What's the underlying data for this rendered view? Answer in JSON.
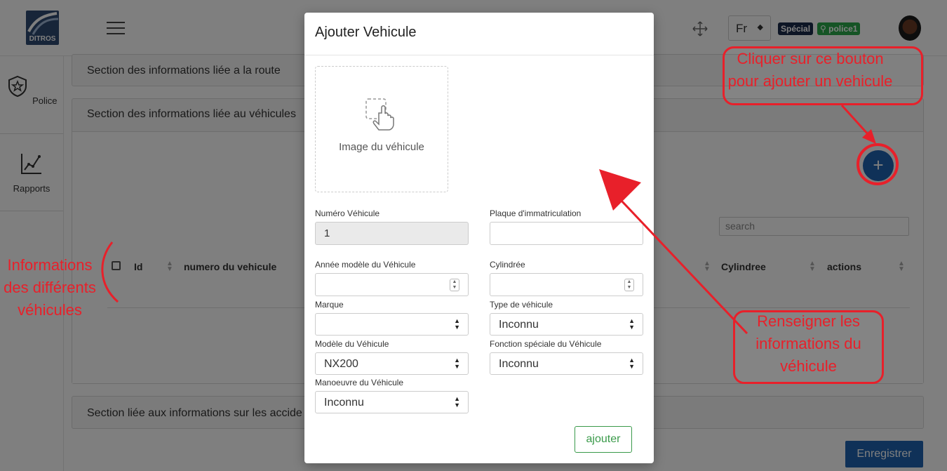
{
  "header": {
    "logo_text": "DITROS",
    "language": "Fr",
    "badge_special": "Spécial",
    "badge_user": "police1"
  },
  "sidebar": {
    "items": [
      {
        "label": "Police",
        "icon": "shield-star-icon"
      },
      {
        "label": "Rapports",
        "icon": "chart-line-icon"
      }
    ]
  },
  "sections": {
    "route": "Section des informations liée a la route",
    "vehicules": "Section des informations liée au véhicules",
    "accidents": "Section liée aux informations sur les accide"
  },
  "table": {
    "search_placeholder": "search",
    "columns": [
      "Id",
      "numero du vehicule",
      "Cylindree",
      "actions"
    ]
  },
  "save_button": "Enregistrer",
  "modal": {
    "title": "Ajouter Vehicule",
    "image_label": "Image du véhicule",
    "fields": {
      "numero": {
        "label": "Numéro Véhicule",
        "value": "1"
      },
      "plaque": {
        "label": "Plaque d'immatriculation",
        "value": ""
      },
      "annee": {
        "label": "Année modèle du Véhicule",
        "value": ""
      },
      "cylindree": {
        "label": "Cylindrée",
        "value": ""
      },
      "marque": {
        "label": "Marque",
        "value": ""
      },
      "type": {
        "label": "Type de véhicule",
        "value": "Inconnu"
      },
      "modele": {
        "label": "Modèle du Véhicule",
        "value": "NX200"
      },
      "fonction": {
        "label": "Fonction spéciale du Véhicule",
        "value": "Inconnu"
      },
      "manoeuvre": {
        "label": "Manoeuvre du Véhicule",
        "value": "Inconnu"
      }
    },
    "submit": "ajouter"
  },
  "annotations": {
    "add_hint_line1": "Cliquer sur ce bouton",
    "add_hint_line2": "pour ajouter un vehicule",
    "fill_hint_line1": "Renseigner les",
    "fill_hint_line2": "informations du",
    "fill_hint_line3": "véhicule",
    "left_hint_line1": "Informations",
    "left_hint_line2": "des différents",
    "left_hint_line3": "véhicules"
  },
  "colors": {
    "annotation_red": "#e8202a",
    "primary_blue": "#1e63b0",
    "success_green": "#3a9a4a",
    "special_badge": "#1b2a4a",
    "user_badge": "#2aa84a"
  }
}
